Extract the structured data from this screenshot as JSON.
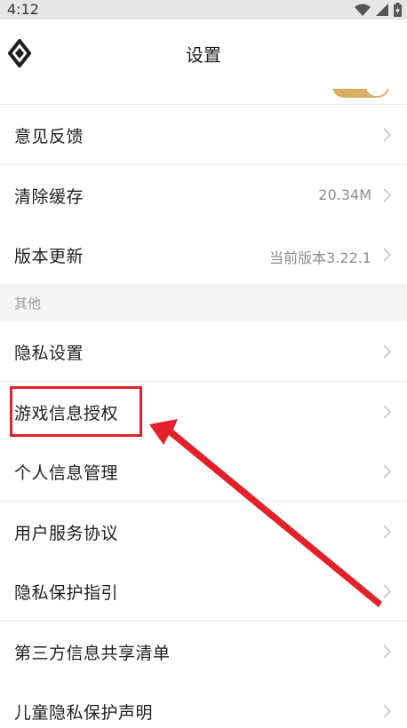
{
  "status_bar": {
    "time": "4:12"
  },
  "header": {
    "title": "设置"
  },
  "rows_top": [
    {
      "label": "意见反馈",
      "value": ""
    },
    {
      "label": "清除缓存",
      "value": "20.34M"
    },
    {
      "label": "版本更新",
      "value": "当前版本3.22.1"
    }
  ],
  "section": {
    "label": "其他"
  },
  "rows_other": [
    {
      "label": "隐私设置"
    },
    {
      "label": "游戏信息授权"
    },
    {
      "label": "个人信息管理"
    },
    {
      "label": "用户服务协议"
    },
    {
      "label": "隐私保护指引"
    },
    {
      "label": "第三方信息共享清单"
    },
    {
      "label": "儿童隐私保护声明"
    }
  ],
  "colors": {
    "accent": "#d8b064",
    "annotation": "#e2212a"
  }
}
